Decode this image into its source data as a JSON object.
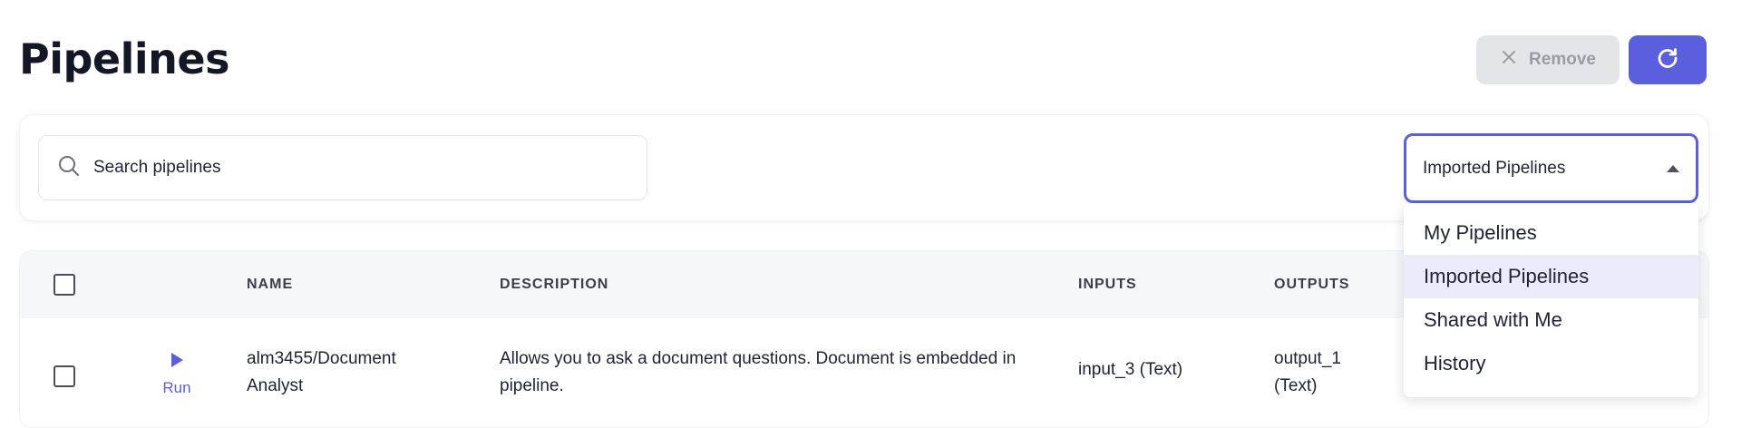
{
  "header": {
    "title": "Pipelines",
    "remove_label": "Remove"
  },
  "search": {
    "placeholder": "Search pipelines",
    "value": ""
  },
  "filter": {
    "selected": "Imported Pipelines",
    "options": [
      "My Pipelines",
      "Imported Pipelines",
      "Shared with Me",
      "History"
    ]
  },
  "table": {
    "columns": [
      "NAME",
      "DESCRIPTION",
      "INPUTS",
      "OUTPUTS"
    ],
    "rows": [
      {
        "run_label": "Run",
        "name": "alm3455/Document Analyst",
        "description": "Allows you to ask a document questions. Document is embedded in pipeline.",
        "inputs": "input_3 (Text)",
        "outputs": "output_1 (Text)"
      }
    ]
  },
  "colors": {
    "accent": "#5b5fde",
    "remove_bg": "#e4e5e8",
    "selected_option_bg": "#ecebfc"
  },
  "icons": [
    "close-icon",
    "refresh-icon",
    "search-icon",
    "caret-up-icon",
    "play-icon"
  ]
}
